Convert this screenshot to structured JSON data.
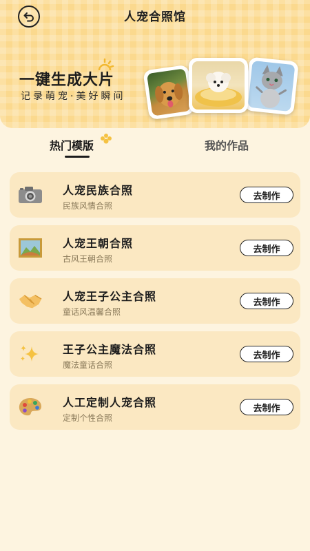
{
  "header": {
    "title": "人宠合照馆",
    "slogan": "一键生成大片",
    "slogan_sub": "记录萌宠·美好瞬间"
  },
  "tabs": [
    {
      "label": "热门模版",
      "active": true
    },
    {
      "label": "我的作品",
      "active": false
    }
  ],
  "templates": [
    {
      "title": "人宠民族合照",
      "subtitle": "民族风情合照",
      "button": "去制作",
      "icon": "camera-icon"
    },
    {
      "title": "人宠王朝合照",
      "subtitle": "古风王朝合照",
      "button": "去制作",
      "icon": "framed-picture-icon"
    },
    {
      "title": "人宠王子公主合照",
      "subtitle": "童话风温馨合照",
      "button": "去制作",
      "icon": "handshake-icon"
    },
    {
      "title": "王子公主魔法合照",
      "subtitle": "魔法童话合照",
      "button": "去制作",
      "icon": "sparkles-icon"
    },
    {
      "title": "人工定制人宠合照",
      "subtitle": "定制个性合照",
      "button": "去制作",
      "icon": "palette-icon"
    }
  ],
  "colors": {
    "background": "#fdf4e0",
    "header": "#fbd98e",
    "card": "#fbe8c2",
    "accent": "#f5c242"
  }
}
